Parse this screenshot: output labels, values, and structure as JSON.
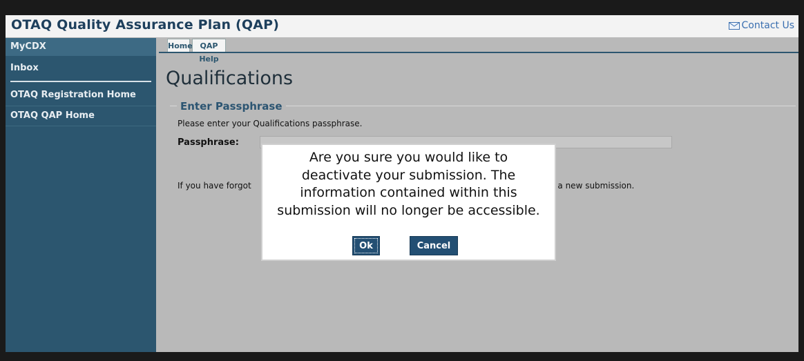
{
  "header": {
    "app_title": "OTAQ Quality Assurance Plan (QAP)",
    "contact_label": "Contact Us",
    "contact_icon": "mail-icon"
  },
  "sidebar": {
    "items": [
      {
        "label": "MyCDX"
      },
      {
        "label": "Inbox"
      },
      {
        "label": "OTAQ Registration Home"
      },
      {
        "label": "OTAQ QAP Home"
      }
    ]
  },
  "tabs": [
    {
      "label": "Home"
    },
    {
      "label": "QAP Help"
    }
  ],
  "main": {
    "page_title": "Qualifications",
    "section_legend": "Enter Passphrase",
    "instruction": "Please enter your Qualifications passphrase.",
    "passphrase_label": "Passphrase:",
    "passphrase_value": "",
    "forgot_text_start": "If you have forgot",
    "forgot_text_end": "in a new submission."
  },
  "dialog": {
    "message_lines": [
      "Are you sure you would like to",
      "deactivate your submission. The",
      "information contained within this",
      "submission will no longer be accessible."
    ],
    "ok_label": "Ok",
    "cancel_label": "Cancel"
  },
  "colors": {
    "sidebar_bg": "#2c566f",
    "title_color": "#1d3f5c",
    "button_bg": "#234f73",
    "link_color": "#3a6fb0"
  }
}
